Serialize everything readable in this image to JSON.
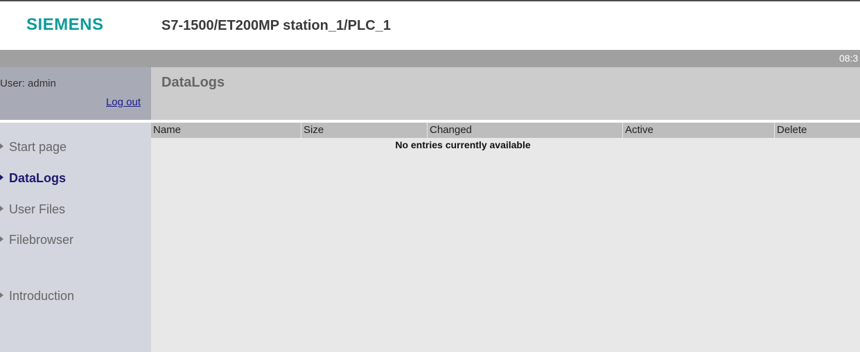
{
  "header": {
    "logo": "SIEMENS",
    "station": "S7-1500/ET200MP station_1/PLC_1"
  },
  "statusbar": {
    "clock": "08:3"
  },
  "user": {
    "label": "User: admin",
    "logout": "Log out"
  },
  "page": {
    "title": "DataLogs"
  },
  "sidebar": {
    "items": [
      {
        "label": "Start page"
      },
      {
        "label": "DataLogs"
      },
      {
        "label": "User Files"
      },
      {
        "label": "Filebrowser"
      },
      {
        "label": "Introduction"
      }
    ],
    "active": "DataLogs"
  },
  "table": {
    "columns": [
      "Name",
      "Size",
      "Changed",
      "Active",
      "Delete"
    ],
    "empty_message": "No entries currently available"
  },
  "colors": {
    "logo": "#0f9a9a",
    "statusbar": "#a0a0a0",
    "sidebar": "#d3d6de",
    "active_nav": "#1a1a6e"
  }
}
